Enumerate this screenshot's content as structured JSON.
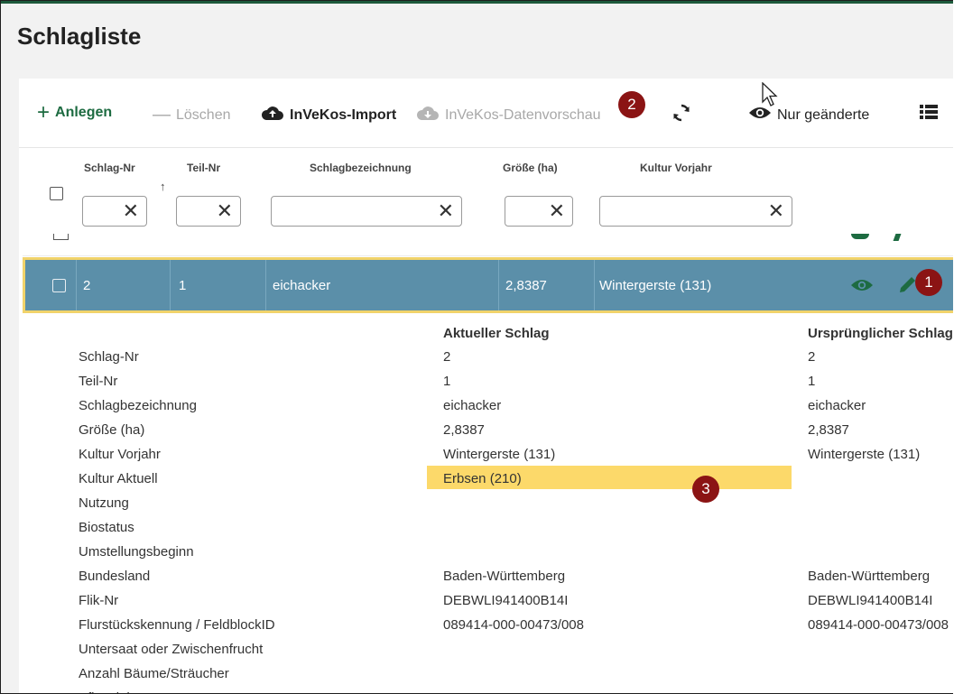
{
  "page": {
    "title": "Schlagliste"
  },
  "toolbar": {
    "anlegen": "Anlegen",
    "loeschen": "Löschen",
    "import": "InVeKos-Import",
    "vorschau": "InVeKos-Datenvorschau",
    "nur_geaenderte": "Nur geänderte"
  },
  "badges": {
    "b1": "1",
    "b2": "2",
    "b3": "3"
  },
  "columns": [
    "Schlag-Nr",
    "Teil-Nr",
    "Schlagbezeichnung",
    "Größe (ha)",
    "Kultur Vorjahr"
  ],
  "selected_row": {
    "schlag_nr": "2",
    "teil_nr": "1",
    "bezeichnung": "eichacker",
    "groesse": "2,8387",
    "kultur_vorjahr": "Wintergerste (131)"
  },
  "details": {
    "header_current": "Aktueller Schlag",
    "header_original": "Ursprünglicher Schlag",
    "rows": [
      {
        "label": "Schlag-Nr",
        "current": "2",
        "original": "2"
      },
      {
        "label": "Teil-Nr",
        "current": "1",
        "original": "1"
      },
      {
        "label": "Schlagbezeichnung",
        "current": "eichacker",
        "original": "eichacker"
      },
      {
        "label": "Größe (ha)",
        "current": "2,8387",
        "original": "2,8387"
      },
      {
        "label": "Kultur Vorjahr",
        "current": "Wintergerste (131)",
        "original": "Wintergerste (131)"
      },
      {
        "label": "Kultur Aktuell",
        "current": "Erbsen (210)",
        "original": ""
      },
      {
        "label": "Nutzung",
        "current": "",
        "original": ""
      },
      {
        "label": "Biostatus",
        "current": "",
        "original": ""
      },
      {
        "label": "Umstellungsbeginn",
        "current": "",
        "original": ""
      },
      {
        "label": "Bundesland",
        "current": "Baden-Württemberg",
        "original": "Baden-Württemberg"
      },
      {
        "label": "Flik-Nr",
        "current": "DEBWLI941400B14I",
        "original": "DEBWLI941400B14I"
      },
      {
        "label": "Flurstückskennung / FeldblockID",
        "current": "089414-000-00473/008",
        "original": "089414-000-00473/008"
      },
      {
        "label": "Untersaat oder Zwischenfrucht",
        "current": "",
        "original": ""
      },
      {
        "label": "Anzahl Bäume/Sträucher",
        "current": "",
        "original": ""
      },
      {
        "label": "Pflanzjahr",
        "current": "",
        "original": ""
      }
    ]
  },
  "colors": {
    "accent": "#1d6b41",
    "selected_row": "#5b8fa9",
    "highlight": "#fcd96a",
    "badge": "#8b1414"
  }
}
